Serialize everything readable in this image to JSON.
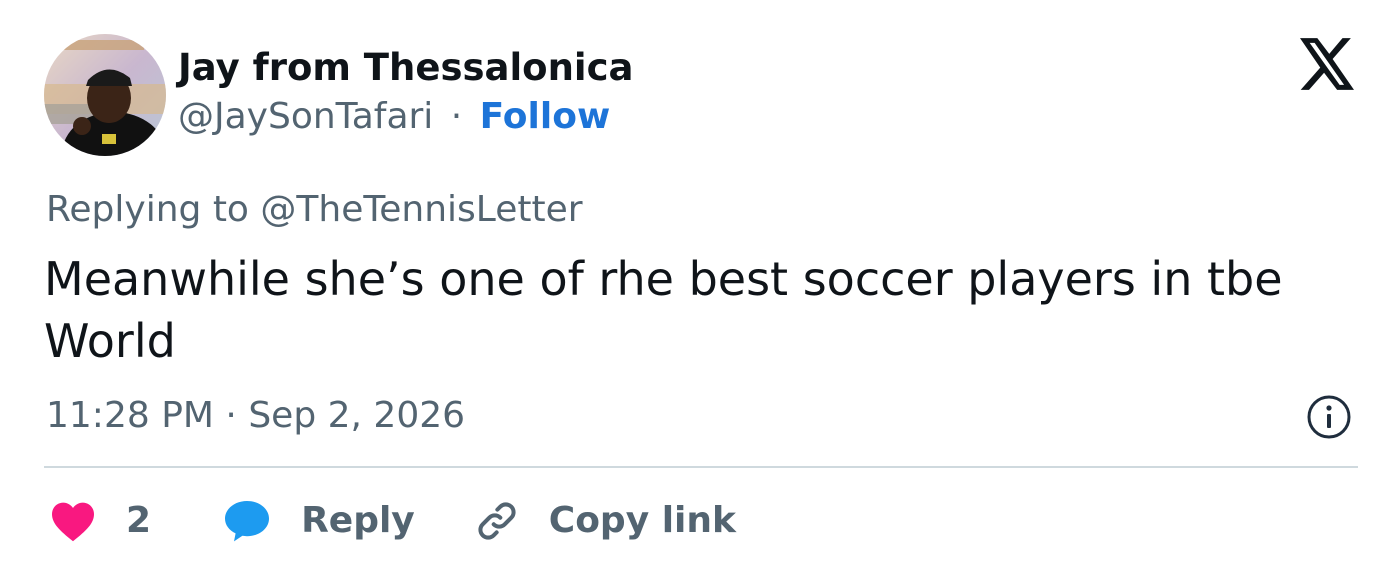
{
  "author": {
    "display_name": "Jay from Thessalonica",
    "handle": "@JaySonTafari",
    "separator": "·",
    "follow_label": "Follow"
  },
  "reply": {
    "prefix": "Replying to",
    "mention": "@TheTennisLetter"
  },
  "tweet": {
    "text": "Meanwhile she’s one of rhe best soccer players in tbe World",
    "time": "11:28 PM",
    "separator": "·",
    "date": "Sep 2, 2026"
  },
  "actions": {
    "like_count": "2",
    "reply_label": "Reply",
    "copy_link_label": "Copy link"
  },
  "icons": {
    "logo": "x-logo-icon",
    "info": "info-icon",
    "like": "heart-icon",
    "reply": "speech-bubble-icon",
    "copy": "link-icon"
  },
  "colors": {
    "accent": "#1d74d8",
    "like": "#f91880",
    "reply_bubble": "#1d9bf0",
    "muted": "#536471",
    "text": "#0f1419",
    "divider": "#cfd9de"
  }
}
